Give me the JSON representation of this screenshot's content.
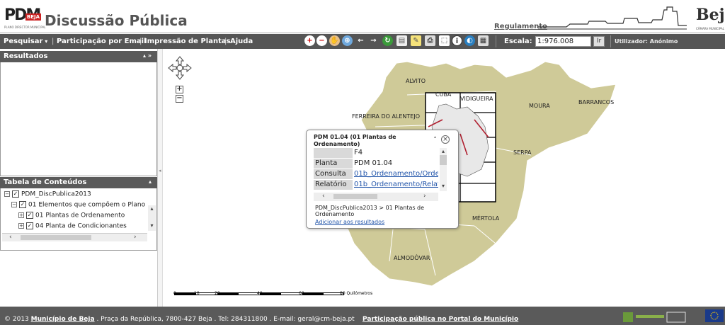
{
  "header": {
    "logo_main": "PDM",
    "logo_badge": "BEJA",
    "logo_sub": "PLANO DIRECTOR MUNICIPAL",
    "title": "Discussão Pública",
    "regulation_link": "Regulamento",
    "city_logo": "Beja",
    "city_logo_sub": "CÂMARA MUNICIPAL"
  },
  "toolbar": {
    "menus": [
      "Pesquisar",
      "Participação por Email",
      "Impressão de Plantas",
      "Ajuda"
    ],
    "tool_icons": [
      "zoom-in-icon",
      "zoom-out-icon",
      "pan-hand-icon",
      "full-extent-icon",
      "back-arrow-icon",
      "forward-arrow-icon",
      "refresh-icon",
      "bookmark-icon",
      "measure-icon",
      "print-icon",
      "select-icon",
      "info-icon",
      "globe-icon",
      "toolbox-icon"
    ],
    "scale_label": "Escala:",
    "scale_value": "1:976.008",
    "go_button": "Ir",
    "user_label": "Utilizador: Anónimo"
  },
  "results_panel": {
    "title": "Resultados",
    "controls": "▴ »"
  },
  "toc_panel": {
    "title": "Tabela de Conteúdos",
    "root": "PDM_DiscPublica2013",
    "group": "01 Elementos que compõem o Plano",
    "items": [
      "01 Plantas de Ordenamento",
      "04 Planta de Condicionantes"
    ]
  },
  "map": {
    "regions": [
      "ALVITO",
      "CUBA",
      "VIDIGUEIRA",
      "MOURA",
      "BARRANCOS",
      "FERREIRA DO ALENTEJO",
      "SERPA",
      "MÉRTOLA",
      "ALMODÔVAR"
    ],
    "scale_ticks": [
      "0",
      "10",
      "20",
      "40",
      "60",
      "80 Quilómetros"
    ]
  },
  "popup": {
    "title": "PDM 01.04  (01 Plantas de Ordenamento)",
    "rows": [
      {
        "key": "",
        "value": "F4",
        "link": false
      },
      {
        "key": "Planta",
        "value": "PDM 01.04",
        "link": false
      },
      {
        "key": "Consulta",
        "value": "01b_Ordenamento/Orde",
        "link": true
      },
      {
        "key": "Relatório",
        "value": "01b_Ordenamento/Relat",
        "link": true
      }
    ],
    "breadcrumb": "PDM_DiscPublica2013 > 01 Plantas de Ordenamento",
    "add_link": "Adicionar aos resultados"
  },
  "footer": {
    "copyright": "© 2013",
    "municipality": "Município de Beja",
    "address": ". Praça da República, 7800-427 Beja . Tel: 284311800 . E-mail: geral@cm-beja.pt",
    "portal_link": "Participação pública no Portal do Município"
  },
  "colors": {
    "map_fill": "#cfca98",
    "toolbar_bg": "#555555",
    "link": "#2255aa"
  }
}
